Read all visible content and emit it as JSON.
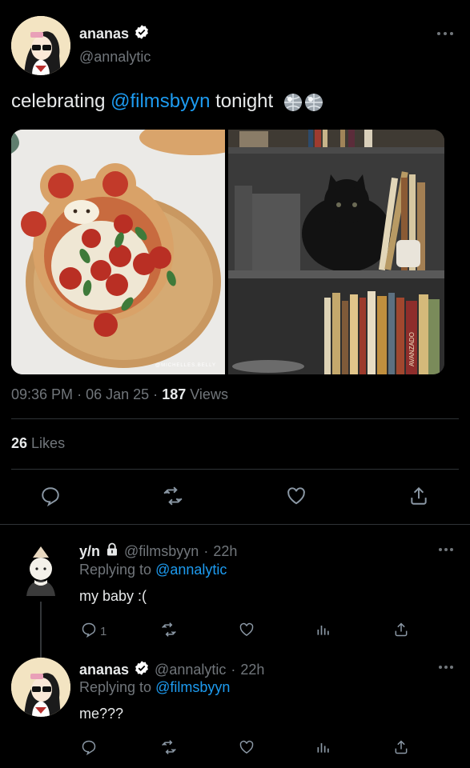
{
  "tweet": {
    "display_name": "ananas",
    "handle": "@annalytic",
    "text_before": "celebrating ",
    "mention": "@filmsbyyn",
    "text_after": " tonight",
    "emoji": "🪩🪩",
    "media_watermark": "@MICHELLES.BELLY",
    "book_spine": "AVANZADO",
    "time": "09:36 PM",
    "date": "06 Jan 25",
    "views_count": "187",
    "views_label": "Views",
    "likes_count": "26",
    "likes_label": "Likes",
    "more_icon": "more-horizontal-icon"
  },
  "replies": [
    {
      "display_name": "y/n",
      "lock_icon": "lock-icon",
      "handle": "@filmsbyyn",
      "time": "22h",
      "replying_label": "Replying to",
      "replying_to": "@annalytic",
      "text": "my baby :(",
      "reply_count": "1"
    },
    {
      "display_name": "ananas",
      "handle": "@annalytic",
      "time": "22h",
      "replying_label": "Replying to",
      "replying_to": "@filmsbyyn",
      "text": "me???",
      "reply_count": ""
    }
  ],
  "separator": "·",
  "colors": {
    "background": "#000000",
    "text": "#e7e9ea",
    "muted": "#71767b",
    "link": "#1d9bf0",
    "divider": "#2f3336"
  }
}
